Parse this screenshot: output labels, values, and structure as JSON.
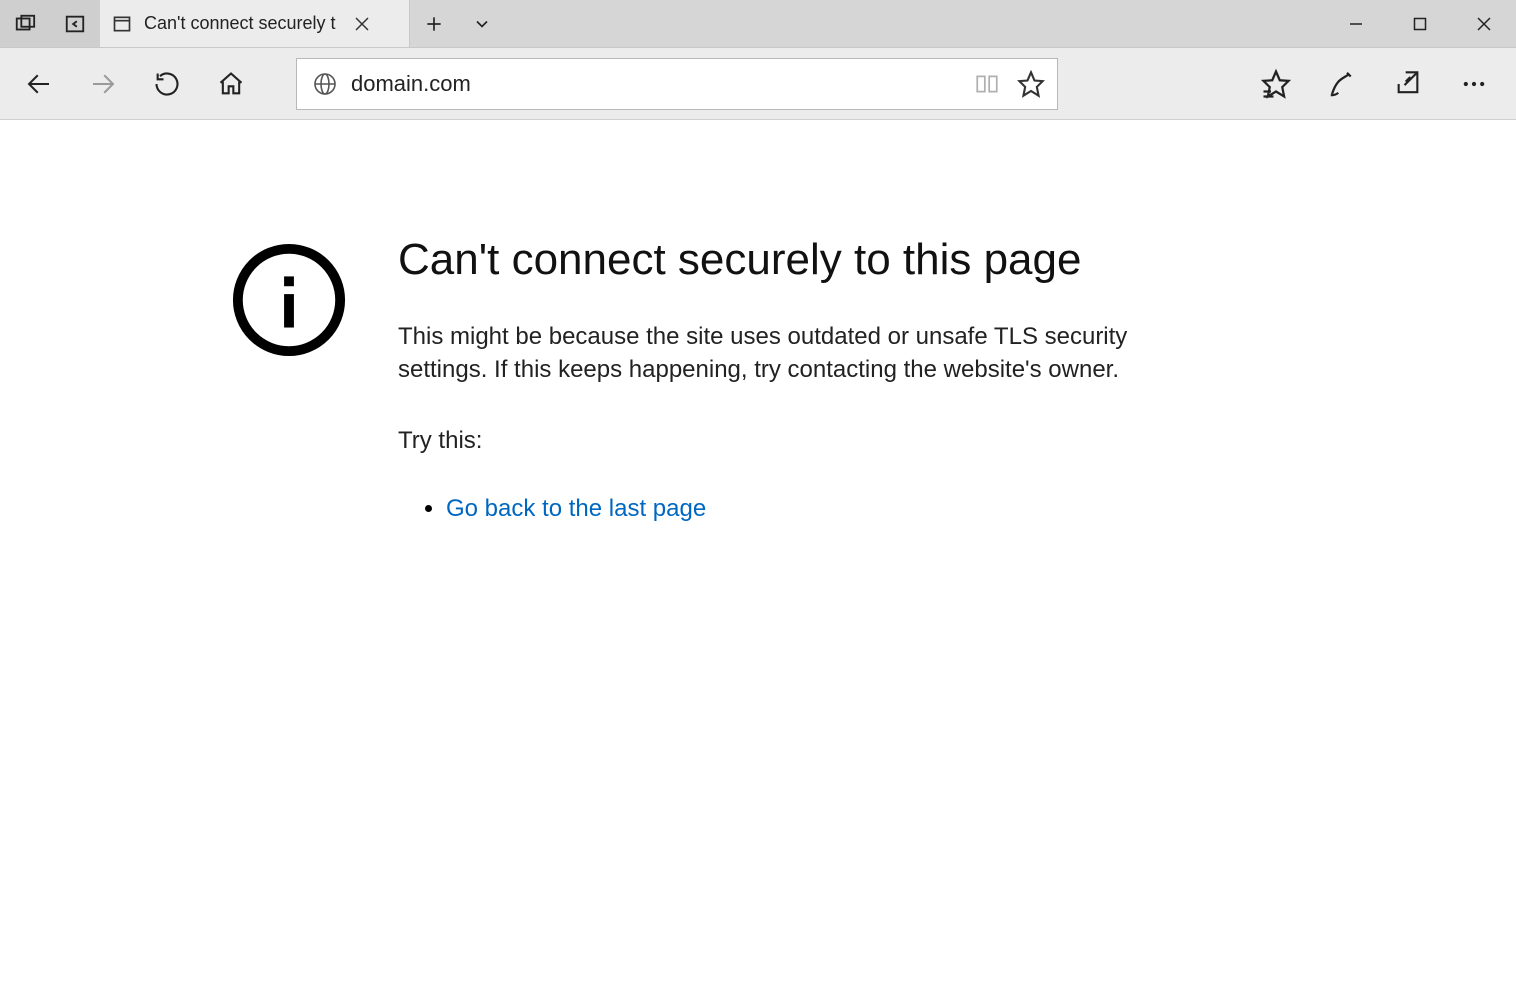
{
  "titlebar": {
    "tab_title": "Can't connect securely t"
  },
  "addressbar": {
    "url": "domain.com"
  },
  "error": {
    "title": "Can't connect securely to this page",
    "description": "This might be because the site uses outdated or unsafe TLS security settings. If this keeps happening, try contacting the website's owner.",
    "try_label": "Try this:",
    "suggestion_link": "Go back to the last page"
  }
}
